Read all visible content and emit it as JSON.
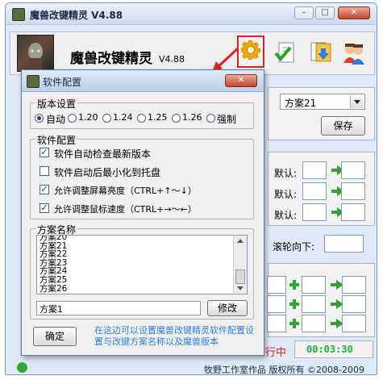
{
  "main_window": {
    "title": "魔兽改键精灵 V4.88",
    "caption_minimize": "–",
    "caption_maximize": "□",
    "caption_close": "✕",
    "app_name": "魔兽改键精灵",
    "app_version": "V4.88",
    "scheme_select": "方案21",
    "save_button": "保存",
    "default_label_1": "默认:",
    "default_label_2": "默认:",
    "default_label_3": "默认:",
    "scroll_down_label": "滚轮向下:",
    "status_text": "行中",
    "timer": "00:03:30",
    "footer": "牧野工作室作品 版权所有 ©2008-2009"
  },
  "dialog": {
    "title": "软件配置",
    "close": "✕",
    "version_group": {
      "caption": "版本设置",
      "options": [
        "自动",
        "1.20",
        "1.24",
        "1.25",
        "1.26",
        "强制"
      ],
      "selected": "自动"
    },
    "software_group": {
      "caption": "软件配置",
      "options": [
        {
          "label": "软件自动检查最新版本",
          "checked": true
        },
        {
          "label": "软件启动后最小化到托盘",
          "checked": false
        },
        {
          "label": "允许调整屏幕亮度（CTRL+↑～↓）",
          "checked": true
        },
        {
          "label": "允许调整鼠标速度（CTRL+→～←）",
          "checked": true
        }
      ]
    },
    "scheme_group": {
      "caption": "方案名称",
      "items": [
        "方案20",
        "方案21",
        "方案22",
        "方案23",
        "方案24",
        "方案25",
        "方案26"
      ],
      "input_value": "方案1",
      "modify_button": "修改"
    },
    "ok_button": "确定",
    "hint": "在这边可以设置魔兽改键精灵软件配置设置与改键方案名称以及魔兽版本"
  },
  "colors": {
    "hint": "#2e7fd9",
    "timer": "#1fae3a",
    "status": "#e02020",
    "highlight": "#e02020"
  }
}
